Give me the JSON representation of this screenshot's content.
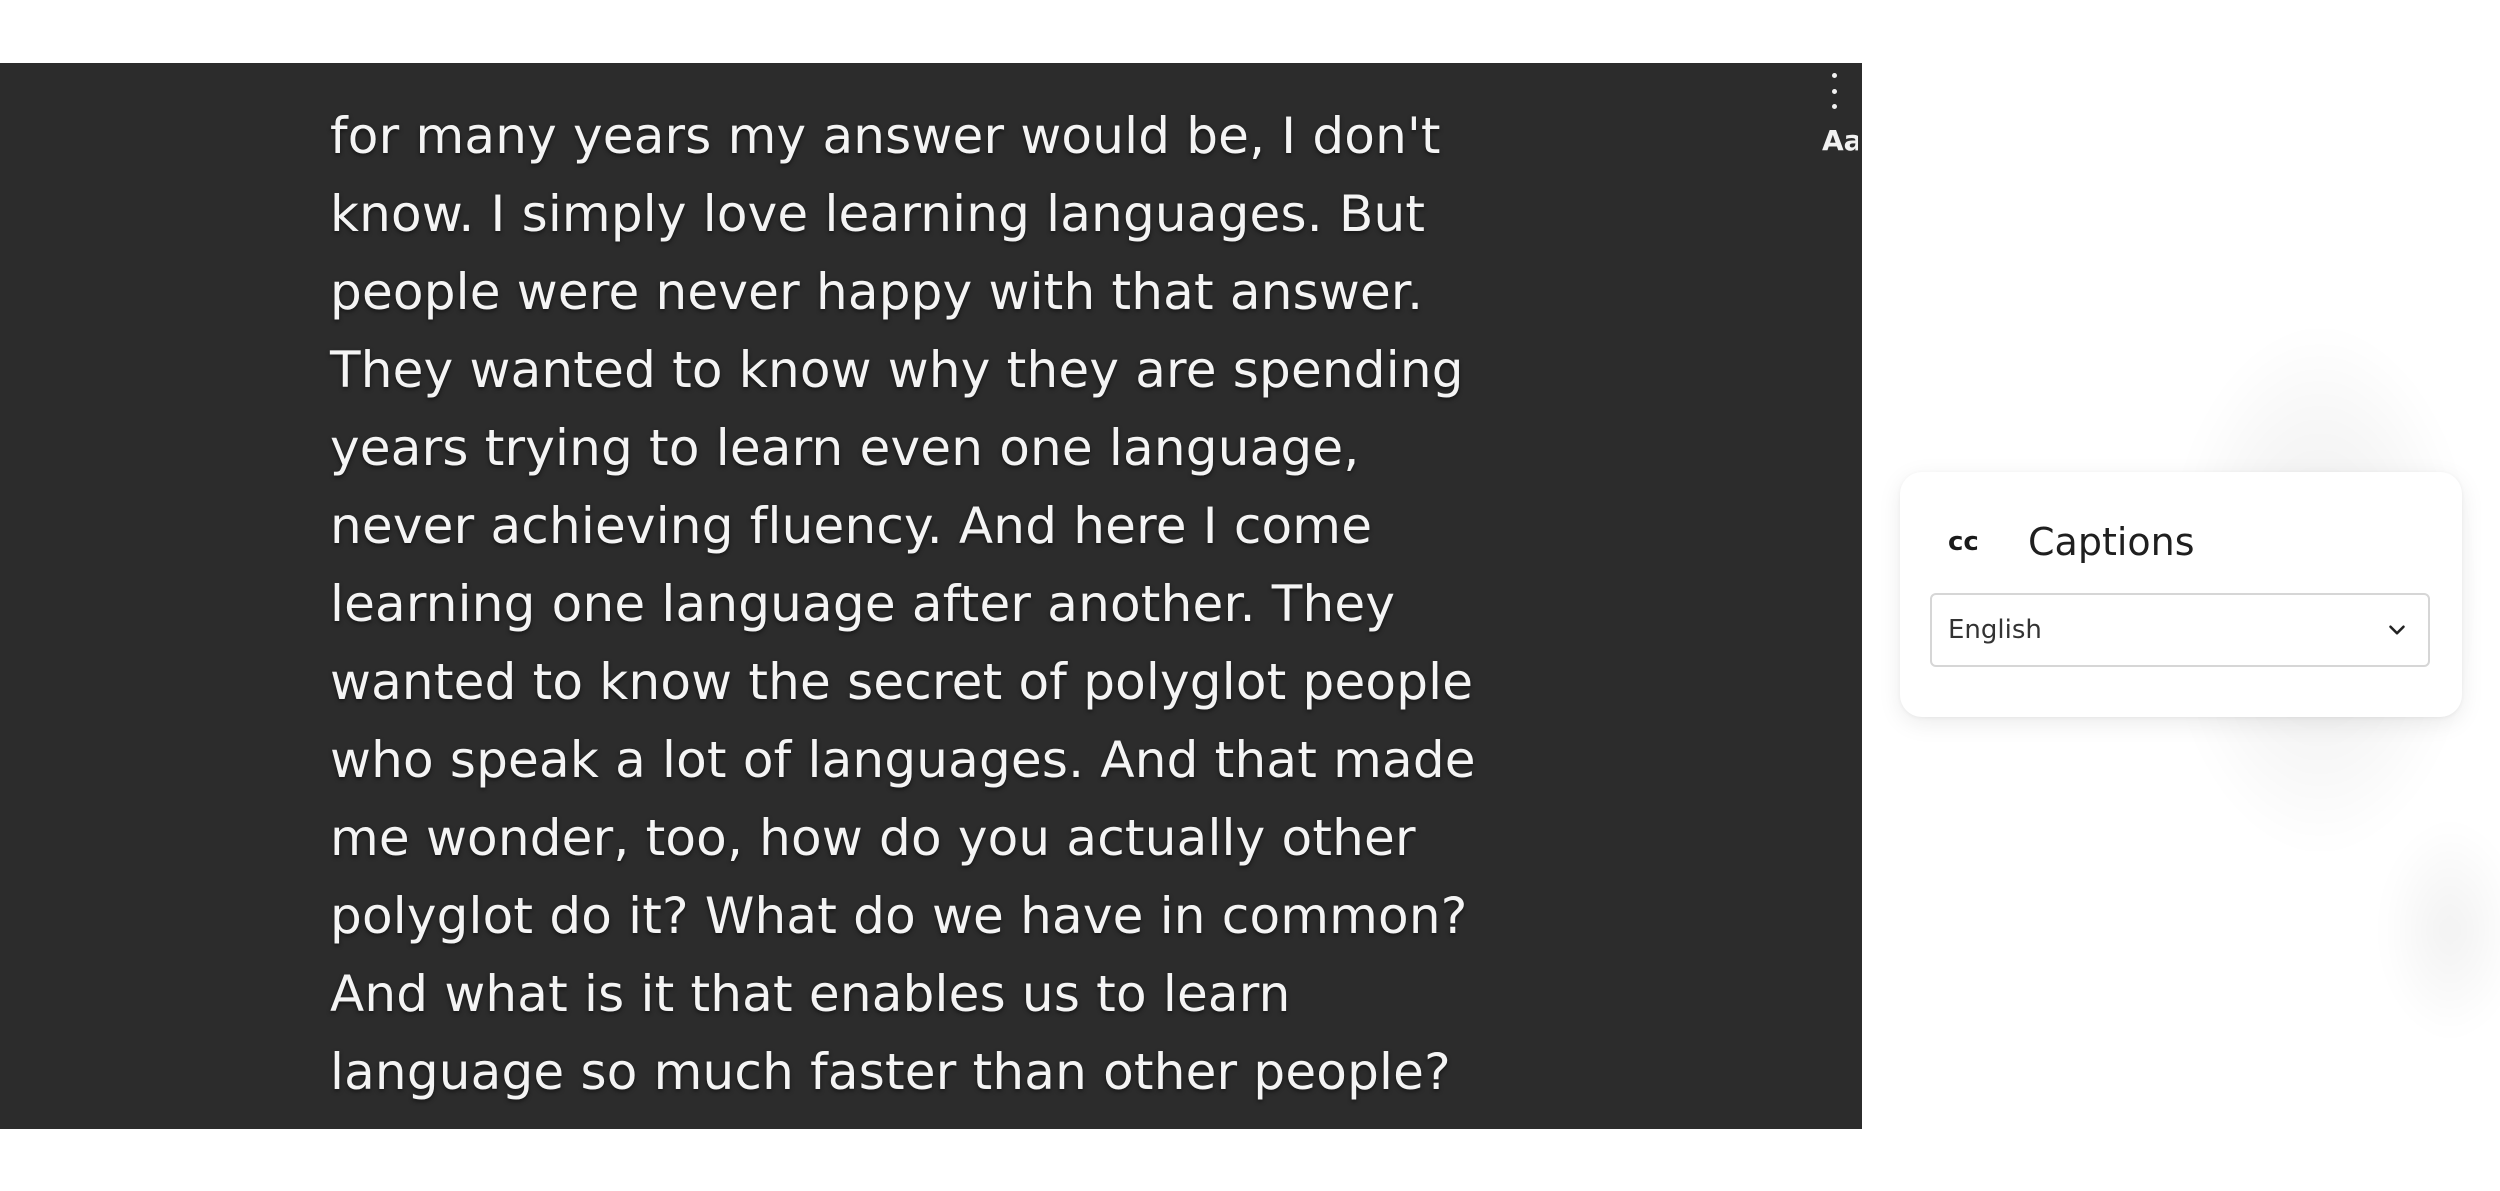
{
  "video": {
    "transcript_lines": [
      "for many years my answer would be, I don't",
      "know. I simply love learning languages. But",
      "people were never happy with that answer.",
      "They wanted to know why they are spending",
      "years trying to learn even one language,",
      "never achieving fluency. And here I come",
      "learning one language after another. They",
      "wanted to know the secret of polyglot people",
      "who speak a lot of languages. And that made",
      "me wonder, too, how do you actually other",
      "polyglot do it? What do we have in common?",
      "And what is it that enables us to learn",
      "language so much faster than other people?"
    ],
    "more_icon": "vertical-ellipsis",
    "font_button_label": "Aa"
  },
  "captions_panel": {
    "icon_label": "cc",
    "title": "Captions",
    "selected_language": "English"
  },
  "colors": {
    "video_background": "#2c2c2c",
    "caption_text": "#f4f4f4",
    "panel_background": "#ffffff"
  }
}
